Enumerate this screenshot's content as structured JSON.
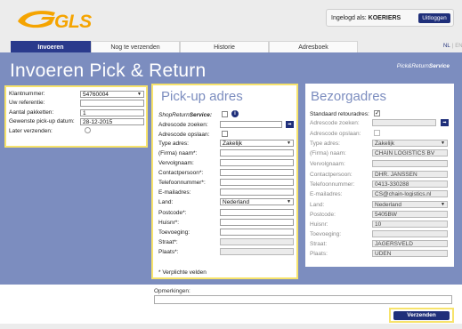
{
  "header": {
    "logo_text": "GLS",
    "login_label": "Ingelogd als:",
    "login_user": "KOERIERS",
    "logout_label": "Uitloggen"
  },
  "tabs": [
    {
      "label": "Invoeren",
      "active": true
    },
    {
      "label": "Nog te verzenden",
      "active": false
    },
    {
      "label": "Historie",
      "active": false
    },
    {
      "label": "Adresboek",
      "active": false
    }
  ],
  "lang": {
    "nl": "NL",
    "en": "EN"
  },
  "page": {
    "title": "Invoeren Pick & Return",
    "brand_prefix": "Pick&Return",
    "brand_suffix": "Service"
  },
  "left": {
    "klantnummer_label": "Klantnummer:",
    "klantnummer_value": "54760004",
    "referentie_label": "Uw referentie:",
    "referentie_value": "",
    "pakketten_label": "Aantal pakketten:",
    "pakketten_value": "1",
    "pickup_label": "Gewenste pick-up datum:",
    "pickup_value": "28-12-2015",
    "later_label": "Later verzenden:"
  },
  "pickup": {
    "title": "Pick-up adres",
    "shop_label_prefix": "ShopReturn",
    "shop_label_suffix": "Service:",
    "adrescode_zoeken_label": "Adrescode zoeken:",
    "adrescode_opslaan_label": "Adrescode opslaan:",
    "type_label": "Type adres:",
    "type_value": "Zakelijk",
    "firma_label": "(Firma) naam*:",
    "vervolg_label": "Vervolgnaam:",
    "contact_label": "Contactpersoon*:",
    "telefoon_label": "Telefoonnummer*:",
    "email_label": "E-mailadres:",
    "land_label": "Land:",
    "land_value": "Nederland",
    "postcode_label": "Postcode*:",
    "huisnr_label": "Huisnr*:",
    "toevoeging_label": "Toevoeging:",
    "straat_label": "Straat*:",
    "plaats_label": "Plaats*:",
    "required_note": "* Verplichte velden"
  },
  "delivery": {
    "title": "Bezorgadres",
    "standaard_label": "Standaard retouradres:",
    "adrescode_zoeken_label": "Adrescode zoeken:",
    "adrescode_opslaan_label": "Adrescode opslaan:",
    "type_label": "Type adres:",
    "type_value": "Zakelijk",
    "firma_label": "(Firma) naam:",
    "firma_value": "CHAIN LOGISTICS BV",
    "vervolg_label": "Vervolgnaam:",
    "vervolg_value": "",
    "contact_label": "Contactpersoon:",
    "contact_value": "DHR. JANSSEN",
    "telefoon_label": "Telefoonnummer:",
    "telefoon_value": "0413-330288",
    "email_label": "E-mailadres:",
    "email_value": "CS@chain-logistics.nl",
    "land_label": "Land:",
    "land_value": "Nederland",
    "postcode_label": "Postcode:",
    "postcode_value": "5405BW",
    "huisnr_label": "Huisnr:",
    "huisnr_value": "10",
    "toevoeging_label": "Toevoeging:",
    "toevoeging_value": "",
    "straat_label": "Straat:",
    "straat_value": "JAGERSVELD",
    "plaats_label": "Plaats:",
    "plaats_value": "UDEN"
  },
  "footer": {
    "remarks_label": "Opmerkingen:",
    "submit_label": "Verzenden"
  },
  "colors": {
    "accent": "#7c8dbf",
    "brand_blue": "#1f2f7a",
    "highlight": "#f7e36b",
    "logo": "#f5a400"
  }
}
